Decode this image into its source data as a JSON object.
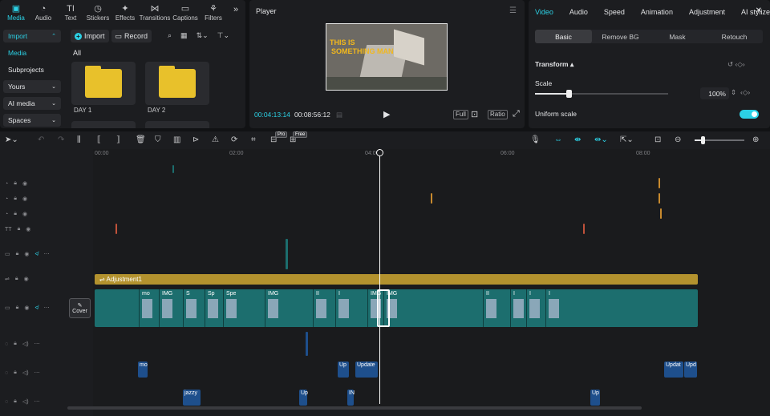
{
  "media_panel": {
    "tabs": [
      {
        "label": "Media",
        "icon": "media-icon",
        "active": true
      },
      {
        "label": "Audio",
        "icon": "audio-icon"
      },
      {
        "label": "Text",
        "icon": "text-icon"
      },
      {
        "label": "Stickers",
        "icon": "stickers-icon"
      },
      {
        "label": "Effects",
        "icon": "effects-icon"
      },
      {
        "label": "Transitions",
        "icon": "transitions-icon"
      },
      {
        "label": "Captions",
        "icon": "captions-icon"
      },
      {
        "label": "Filters",
        "icon": "filters-icon"
      }
    ],
    "more": "»",
    "sidebar": [
      {
        "label": "Import",
        "chevron": true,
        "active": true
      },
      {
        "label": "Media",
        "selected": true
      },
      {
        "label": "Subprojects"
      },
      {
        "label": "Yours",
        "chevron": true
      },
      {
        "label": "AI media",
        "chevron": true
      },
      {
        "label": "Spaces",
        "chevron": true
      }
    ],
    "import_label": "Import",
    "record_label": "Record",
    "all_label": "All",
    "folders": [
      "DAY 1",
      "DAY 2"
    ]
  },
  "player": {
    "title": "Player",
    "video_text_line1": "THIS IS",
    "video_text_line2": "SOMETHING MAN",
    "current_time": "00:04:13:14",
    "total_time": "00:08:56:12",
    "full_label": "Full",
    "ratio_label": "Ratio"
  },
  "inspector": {
    "tabs": [
      "Video",
      "Audio",
      "Speed",
      "Animation",
      "Adjustment",
      "AI stylize"
    ],
    "subtabs": [
      "Basic",
      "Remove BG",
      "Mask",
      "Retouch"
    ],
    "transform_label": "Transform",
    "scale_label": "Scale",
    "scale_value": "100%",
    "scale_fraction": 0.25,
    "uniform_scale_label": "Uniform scale",
    "uniform_scale_on": true
  },
  "toolbar_badges": {
    "pro": "Pro",
    "free": "Free"
  },
  "timeline": {
    "ruler_labels": [
      "00:00",
      "02:00",
      "04:00",
      "06:00",
      "08:00"
    ],
    "adjustment_label": "Adjustment1",
    "cover_label": "Cover",
    "video_clip_labels": [
      "mo",
      "IMG",
      "S",
      "Sp",
      "Spe",
      "IMG",
      "II",
      "I",
      "IMG",
      "IMG",
      "II",
      "I",
      "I",
      "I"
    ],
    "audio_clips": {
      "row2": [
        "mo",
        "Up",
        "Update",
        "Updat",
        "Upd"
      ],
      "row3": [
        "jazzy",
        "Up",
        "IN",
        "Up"
      ]
    }
  },
  "colors": {
    "accent": "#2cd1e5",
    "adjustment": "#b3922e",
    "video_track": "#1c6e6e",
    "audio_clip": "#1e4f8c"
  }
}
